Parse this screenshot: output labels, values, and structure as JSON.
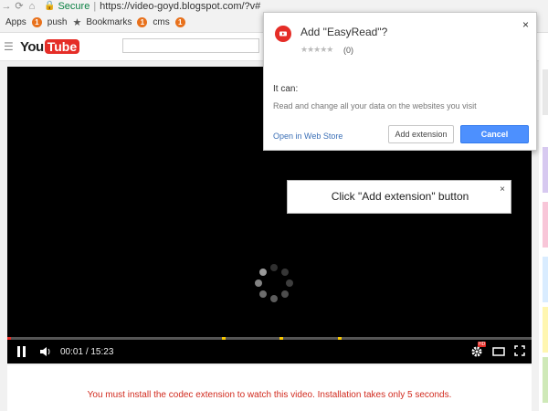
{
  "browser": {
    "secure_label": "Secure",
    "url_separator": "|",
    "url": "https://video-goyd.blogspot.com/?v#",
    "bookmarks": [
      {
        "label": "Apps",
        "badge": "1"
      },
      {
        "label": "push"
      },
      {
        "label": "Bookmarks",
        "badge": "1"
      },
      {
        "label": "cms",
        "badge": "1"
      }
    ]
  },
  "youtube": {
    "logo_you": "You",
    "logo_tube": "Tube",
    "search_value": ""
  },
  "player": {
    "current_time": "00:01",
    "time_separator": "/",
    "duration": "15:23",
    "progress": 0.003,
    "hd_badge": "HD",
    "accent_color": "#e52d27",
    "ad_marker_color": "#f9c800",
    "ad_markers": [
      0.41,
      0.52,
      0.63
    ]
  },
  "notice": {
    "text": "You must install the codec extension to watch this video. Installation takes only 5 seconds."
  },
  "dialog": {
    "title": "Add \"EasyRead\"?",
    "stars": "★★★★★",
    "rating_count": "(0)",
    "close": "×",
    "it_can": "It can:",
    "permission": "Read and change all your data on the websites you visit",
    "web_store_link": "Open in Web Store",
    "add_button": "Add extension",
    "cancel_button": "Cancel"
  },
  "tooltip": {
    "text": "Click \"Add extension\" button",
    "close": "×"
  },
  "side_strip_colors": [
    "#e8e8e8",
    "#d7c9f0",
    "#f8c6d8",
    "#d9ecff",
    "#fff6b0",
    "#cfe9b8"
  ]
}
